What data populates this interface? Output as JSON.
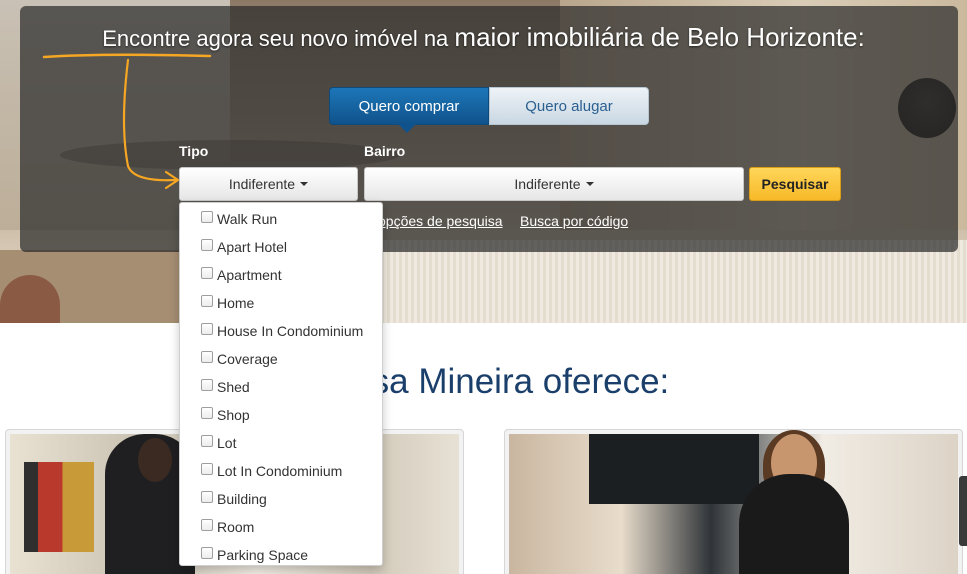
{
  "hero": {
    "headline_prefix": "Encontre agora seu novo imóvel na ",
    "headline_emphasis": "maior imobiliária de Belo Horizonte:"
  },
  "tabs": [
    {
      "label": "Quero comprar",
      "active": true
    },
    {
      "label": "Quero alugar",
      "active": false
    }
  ],
  "search": {
    "tipo_label": "Tipo",
    "tipo_value": "Indiferente",
    "bairro_label": "Bairro",
    "bairro_value": "Indiferente",
    "submit_label": "Pesquisar",
    "options_link": "opções de pesquisa",
    "code_link": "Busca por código"
  },
  "tipo_options": [
    "Walk Run",
    "Apart Hotel",
    "Apartment",
    "Home",
    "House In Condominium",
    "Coverage",
    "Shed",
    "Shop",
    "Lot",
    "Lot In Condominium",
    "Building",
    "Room",
    "Parking Space"
  ],
  "section": {
    "title_visible": "a Casa Mineira oferece:"
  },
  "colors": {
    "accent_blue": "#10538c",
    "search_yellow": "#f7b928",
    "title_blue": "#1b3f6b",
    "headline_arrow": "#f5a623"
  }
}
